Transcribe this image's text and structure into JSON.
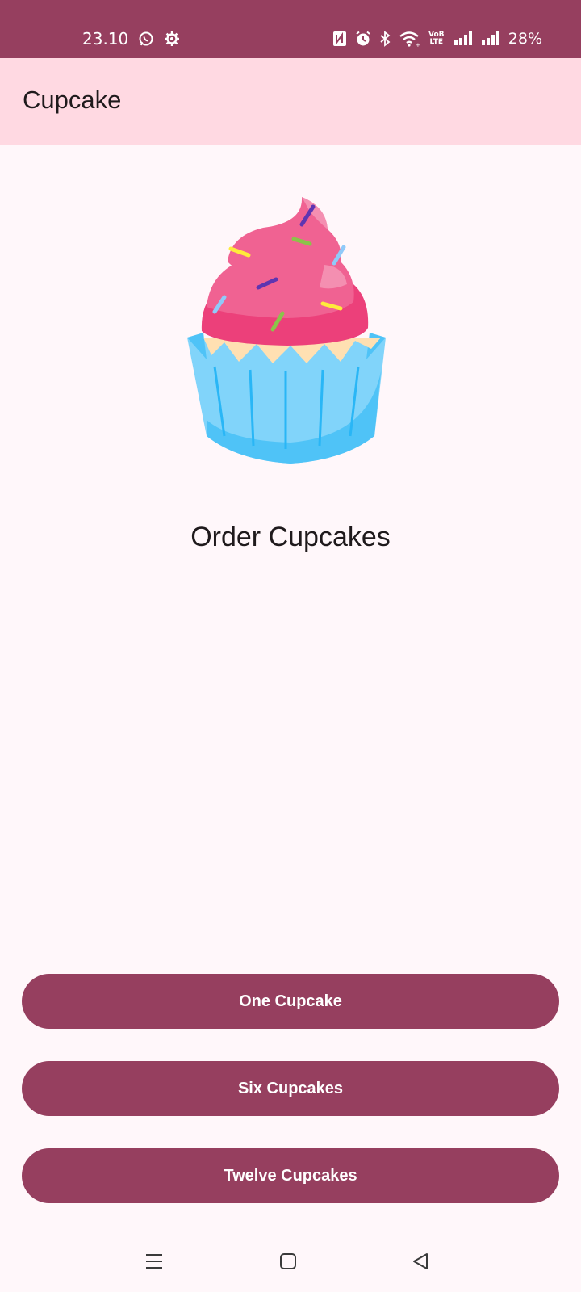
{
  "status_bar": {
    "time": "23.10",
    "network_label": "VoB LTE",
    "battery": "28%",
    "icons": [
      "whatsapp-icon",
      "settings-gear-icon",
      "nfc-icon",
      "alarm-icon",
      "bluetooth-icon",
      "wifi-icon",
      "signal-icon",
      "signal-icon",
      "battery-icon"
    ]
  },
  "app_bar": {
    "title": "Cupcake"
  },
  "main": {
    "image_icon": "cupcake-image",
    "title": "Order Cupcakes"
  },
  "buttons": {
    "one": "One Cupcake",
    "six": "Six Cupcakes",
    "twelve": "Twelve Cupcakes"
  },
  "nav": {
    "icons": [
      "menu-icon",
      "home-icon",
      "back-icon"
    ]
  },
  "colors": {
    "primary": "#963F5F",
    "app_bar": "#FFD9E2",
    "background": "#FFF7FA",
    "frosting": "#F06292",
    "cup": "#81D4FA"
  }
}
